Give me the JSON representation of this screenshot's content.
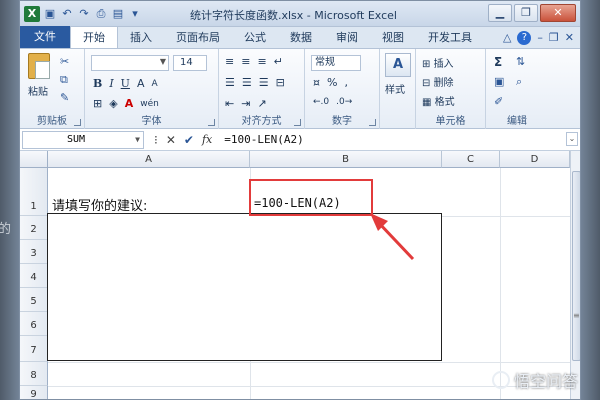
{
  "window": {
    "title": "统计字符长度函数.xlsx - Microsoft Excel",
    "app_badge": "X"
  },
  "tabs": [
    "文件",
    "开始",
    "插入",
    "页面布局",
    "公式",
    "数据",
    "审阅",
    "视图",
    "开发工具"
  ],
  "active_tab": "开始",
  "ribbon": {
    "clipboard": {
      "paste_label": "粘贴",
      "group_label": "剪贴板"
    },
    "font": {
      "font_size": "14",
      "group_label": "字体",
      "bold": "B",
      "italic": "I",
      "underline": "U",
      "grow": "A",
      "shrink": "A",
      "font_color": "A",
      "phonetic": "wén"
    },
    "alignment": {
      "group_label": "对齐方式"
    },
    "number": {
      "format": "常规",
      "percent": "%",
      "comma": ",",
      "group_label": "数字"
    },
    "styles": {
      "label": "样式"
    },
    "cells": {
      "insert": "插入",
      "delete": "删除",
      "format": "格式",
      "group_label": "单元格"
    },
    "editing": {
      "sum": "Σ",
      "group_label": "编辑"
    }
  },
  "formula_bar": {
    "name_box": "SUM",
    "formula": "=100-LEN(A2)"
  },
  "grid": {
    "columns": [
      "A",
      "B",
      "C",
      "D"
    ],
    "rows": [
      "1",
      "2",
      "3",
      "4",
      "5",
      "6",
      "7",
      "8",
      "9"
    ],
    "cells": {
      "A1": "请填写你的建议:",
      "B1": "=100-LEN(A2)"
    }
  },
  "background": {
    "ghost_text": "的"
  },
  "watermark": "悟空问答",
  "colors": {
    "highlight": "#e23b3b",
    "file_tab": "#2a5aa0",
    "excel_green": "#1f7a3a"
  }
}
